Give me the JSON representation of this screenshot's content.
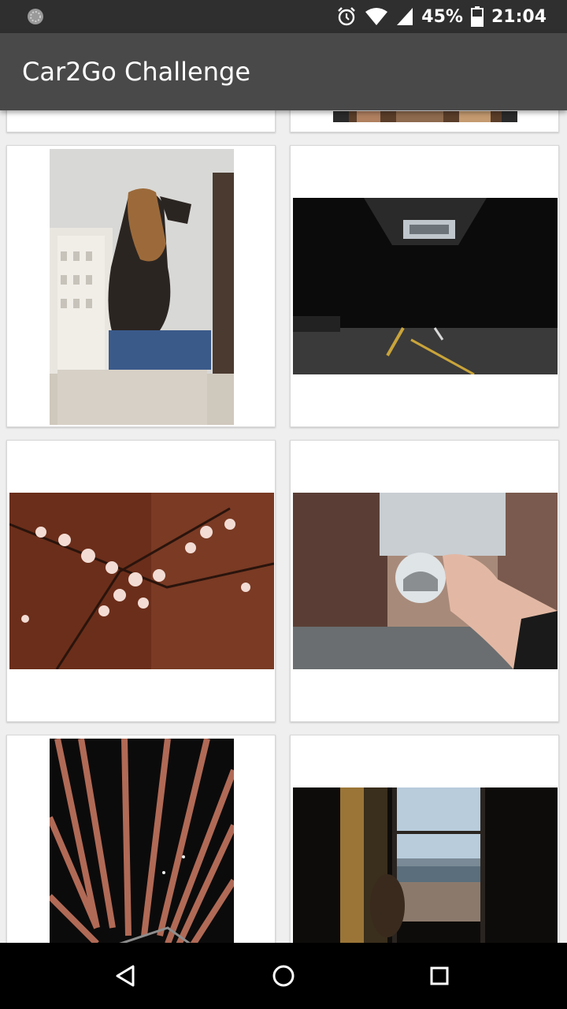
{
  "status_bar": {
    "battery_percent": "45%",
    "time": "21:04",
    "icons": [
      "sync-icon",
      "alarm-icon",
      "wifi-icon",
      "cellular-signal-icon",
      "battery-icon"
    ]
  },
  "app_bar": {
    "title": "Car2Go Challenge",
    "background": "#494949"
  },
  "gallery": {
    "items": [
      {
        "subject": "partial-card-left"
      },
      {
        "subject": "partial-card-right-building"
      },
      {
        "subject": "woman-long-hair-on-rooftop"
      },
      {
        "subject": "dark-tunnel-road"
      },
      {
        "subject": "cherry-blossom-branches"
      },
      {
        "subject": "hand-holding-crystal-ball"
      },
      {
        "subject": "red-ceiling-beams"
      },
      {
        "subject": "window-city-view"
      }
    ]
  },
  "nav_bar": {
    "icons": [
      "back-icon",
      "home-icon",
      "recents-icon"
    ]
  }
}
